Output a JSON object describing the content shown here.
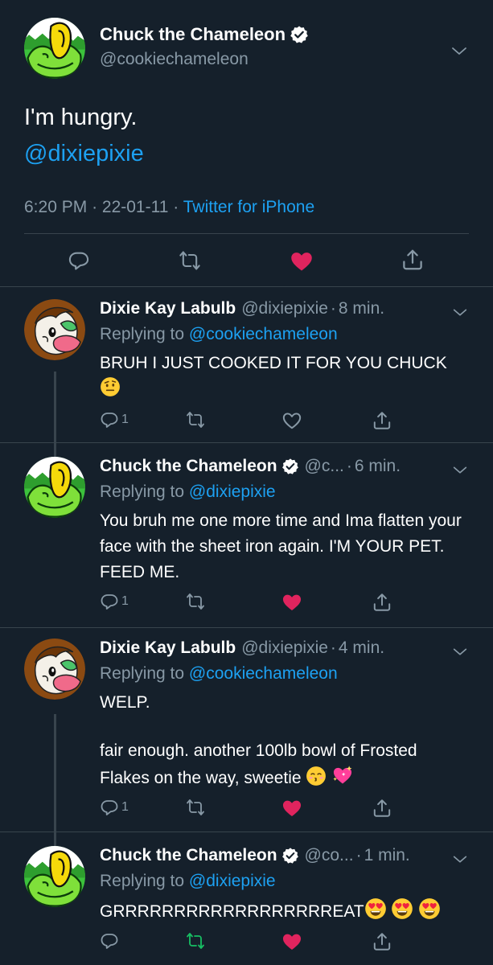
{
  "main_tweet": {
    "author_name": "Chuck the Chameleon",
    "handle": "@cookiechameleon",
    "text": "I'm hungry.",
    "mention": "@dixiepixie",
    "time": "6:20 PM",
    "date": "22-01-11",
    "separator": "·",
    "source": "Twitter for iPhone",
    "liked": true
  },
  "replies": [
    {
      "author_name": "Dixie Kay Labulb",
      "handle": "@dixiepixie",
      "time": "8 min.",
      "replying_label": "Replying to",
      "replying_to": "@cookiechameleon",
      "text": "BRUH I JUST COOKED IT FOR YOU CHUCK",
      "emoji": "face-with-raised-eyebrow",
      "reply_count": "1",
      "liked": false
    },
    {
      "author_name": "Chuck the Chameleon",
      "handle": "@c...",
      "time": "6 min.",
      "replying_label": "Replying to",
      "replying_to": "@dixiepixie",
      "text": "You bruh me one more time and Ima flatten your face with the sheet iron again. I'M YOUR PET. FEED ME.",
      "reply_count": "1",
      "liked": true
    },
    {
      "author_name": "Dixie Kay Labulb",
      "handle": "@dixiepixie",
      "time": "4 min.",
      "replying_label": "Replying to",
      "replying_to": "@cookiechameleon",
      "text_line1": "WELP.",
      "text_line2": "fair enough. another 100lb bowl of Frosted Flakes on the way, sweetie",
      "emojis": [
        "kissing-face",
        "sparkling-heart"
      ],
      "reply_count": "1",
      "liked": true
    },
    {
      "author_name": "Chuck the Chameleon",
      "handle": "@co...",
      "time": "1 min.",
      "replying_label": "Replying to",
      "replying_to": "@dixiepixie",
      "text": "GRRRRRRRRRRRRRRRRRREAT",
      "emojis": [
        "heart-eyes",
        "heart-eyes",
        "heart-eyes"
      ],
      "reply_count": "",
      "liked": true,
      "retweeted": true
    }
  ],
  "colors": {
    "background": "#15202b",
    "text": "#ffffff",
    "muted": "#8899a6",
    "link": "#1da1f2",
    "like": "#e0245e",
    "retweet": "#17bf63",
    "divider": "#38444d"
  },
  "icons": [
    "verified-badge-icon",
    "chevron-down-icon",
    "reply-icon",
    "retweet-icon",
    "heart-icon",
    "share-icon"
  ]
}
